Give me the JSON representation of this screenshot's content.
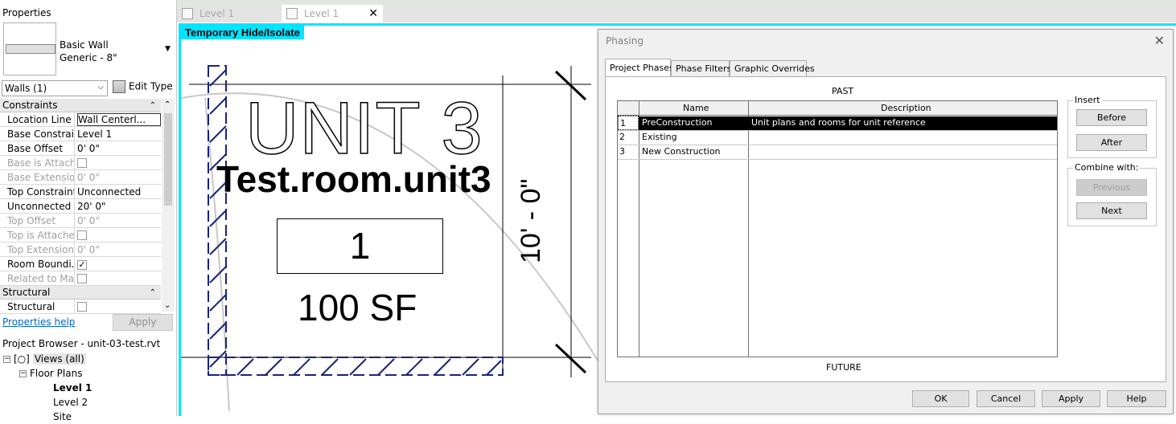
{
  "properties": {
    "title": "Properties",
    "type_name_line1": "Basic Wall",
    "type_name_line2": "Generic - 8\"",
    "selector": "Walls (1)",
    "edit_type": "Edit Type",
    "groups": {
      "constraints": "Constraints",
      "structural": "Structural"
    },
    "rows": [
      {
        "key": "Location Line",
        "value": "Wall Centerl..."
      },
      {
        "key": "Base Constraint",
        "value": "Level 1"
      },
      {
        "key": "Base Offset",
        "value": "0'  0\""
      },
      {
        "key": "Base is Attach...",
        "value": ""
      },
      {
        "key": "Base Extensio...",
        "value": "0'  0\""
      },
      {
        "key": "Top Constraint",
        "value": "Unconnected"
      },
      {
        "key": "Unconnected ...",
        "value": "20'  0\""
      },
      {
        "key": "Top Offset",
        "value": "0'  0\""
      },
      {
        "key": "Top is Attached",
        "value": ""
      },
      {
        "key": "Top Extension...",
        "value": "0'  0\""
      },
      {
        "key": "Room Boundi...",
        "value": ""
      },
      {
        "key": "Related to Mass",
        "value": ""
      },
      {
        "key": "Structural",
        "value": ""
      }
    ],
    "help_link": "Properties help",
    "apply": "Apply"
  },
  "project_browser": {
    "title": "Project Browser - unit-03-test.rvt",
    "views_all": "Views (all)",
    "floor_plans": "Floor Plans",
    "level1": "Level 1",
    "level2": "Level 2",
    "site": "Site"
  },
  "view_tabs": [
    {
      "label": "Level 1"
    },
    {
      "label": "Level 1",
      "close": "✕"
    }
  ],
  "canvas": {
    "banner": "Temporary Hide/Isolate",
    "unit_label": "UNIT 3",
    "room_name": "Test.room.unit3",
    "room_number": "1",
    "area": "100 SF",
    "dimension": "10' - 0\""
  },
  "dialog": {
    "title": "Phasing",
    "close": "✕",
    "tabs": [
      "Project Phases",
      "Phase Filters",
      "Graphic Overrides"
    ],
    "past": "PAST",
    "future": "FUTURE",
    "columns": [
      "Name",
      "Description"
    ],
    "phases": [
      {
        "num": "1",
        "name": "PreConstruction",
        "description": "Unit plans and rooms for unit reference"
      },
      {
        "num": "2",
        "name": "Existing",
        "description": ""
      },
      {
        "num": "3",
        "name": "New Construction",
        "description": ""
      }
    ],
    "insert_label": "Insert",
    "before": "Before",
    "after": "After",
    "combine_label": "Combine with:",
    "previous": "Previous",
    "next": "Next",
    "ok": "OK",
    "cancel": "Cancel",
    "apply": "Apply",
    "help": "Help"
  },
  "colors": {
    "isolate_cyan": "#00e5ff",
    "wall_hatch": "#1a237e"
  }
}
